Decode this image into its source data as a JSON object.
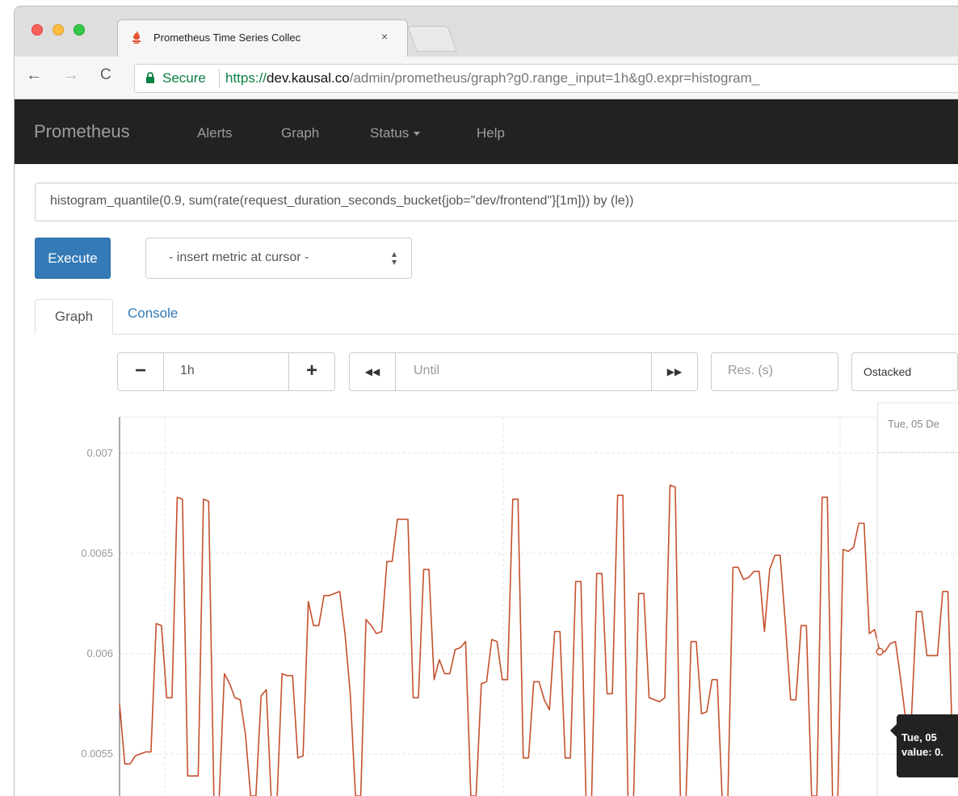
{
  "browser": {
    "tab_title": "Prometheus Time Series Collec",
    "tab_close": "×",
    "secure_label": "Secure",
    "url_scheme": "https://",
    "url_host": "dev.kausal.co",
    "url_rest": "/admin/prometheus/graph?g0.range_input=1h&g0.expr=histogram_",
    "nav_back": "←",
    "nav_forward": "→",
    "nav_reload": "C"
  },
  "navbar": {
    "brand": "Prometheus",
    "alerts": "Alerts",
    "graph": "Graph",
    "status": "Status",
    "help": "Help"
  },
  "query": {
    "expression": "histogram_quantile(0.9, sum(rate(request_duration_seconds_bucket{job=\"dev/frontend\"}[1m])) by (le))",
    "execute_label": "Execute",
    "metric_select": "- insert metric at cursor -",
    "select_arrows": "▲▼"
  },
  "tabs": {
    "graph": "Graph",
    "console": "Console"
  },
  "controls": {
    "range_minus": "−",
    "range_value": "1h",
    "range_plus": "+",
    "until_back": "◀◀",
    "until_placeholder": "Until",
    "until_forward": "▶▶",
    "res_placeholder": "Res. (s)",
    "stacked_label": "stacked",
    "stacked_radio": "O"
  },
  "chart_data": {
    "type": "line",
    "yticks": [
      "0.007",
      "0.0065",
      "0.006",
      "0.0055"
    ],
    "ylim": [
      0.00529,
      0.00718
    ],
    "hover_time_label": "Tue, 05 De",
    "tooltip_line1": "Tue, 05",
    "tooltip_line2": "value: 0.",
    "color": "#c5502d",
    "values": [
      0.00575,
      0.00545,
      0.00545,
      0.00549,
      0.0055,
      0.00551,
      0.00551,
      0.00615,
      0.00614,
      0.00578,
      0.00578,
      0.00678,
      0.00677,
      0.00539,
      0.00539,
      0.00539,
      0.00677,
      0.00676,
      0.00528,
      0.00528,
      0.0059,
      0.00585,
      0.00578,
      0.00577,
      0.0056,
      0.00529,
      0.00529,
      0.00579,
      0.00582,
      0.00524,
      0.00524,
      0.0059,
      0.00589,
      0.00589,
      0.00548,
      0.00549,
      0.00626,
      0.00614,
      0.00614,
      0.00629,
      0.00629,
      0.0063,
      0.00631,
      0.0061,
      0.0058,
      0.00529,
      0.00529,
      0.00617,
      0.00614,
      0.0061,
      0.00611,
      0.00646,
      0.00646,
      0.00667,
      0.00667,
      0.00667,
      0.00578,
      0.00578,
      0.00642,
      0.00642,
      0.00587,
      0.00597,
      0.0059,
      0.0059,
      0.00602,
      0.00603,
      0.00606,
      0.00529,
      0.00529,
      0.00585,
      0.00586,
      0.00607,
      0.00606,
      0.00587,
      0.00587,
      0.00677,
      0.00677,
      0.00548,
      0.00548,
      0.00586,
      0.00586,
      0.00577,
      0.00572,
      0.00611,
      0.00611,
      0.00548,
      0.00548,
      0.00636,
      0.00636,
      0.00524,
      0.00524,
      0.0064,
      0.0064,
      0.0058,
      0.0058,
      0.00679,
      0.00679,
      0.00524,
      0.00524,
      0.0063,
      0.0063,
      0.00578,
      0.00577,
      0.00576,
      0.00578,
      0.00684,
      0.00683,
      0.00524,
      0.00524,
      0.00606,
      0.00606,
      0.0057,
      0.00571,
      0.00587,
      0.00587,
      0.00524,
      0.00524,
      0.00643,
      0.00643,
      0.00637,
      0.00638,
      0.00641,
      0.00641,
      0.00611,
      0.00642,
      0.00649,
      0.00649,
      0.00615,
      0.00577,
      0.00577,
      0.00614,
      0.00614,
      0.00529,
      0.00529,
      0.00678,
      0.00678,
      0.00528,
      0.00528,
      0.00652,
      0.00651,
      0.00653,
      0.00665,
      0.00665,
      0.0061,
      0.00612,
      0.00601,
      0.00601,
      0.00605,
      0.00606,
      0.00587,
      0.00566,
      0.00566,
      0.00621,
      0.00621,
      0.00599,
      0.00599,
      0.00599,
      0.00631,
      0.00631,
      0.00543,
      0.00543,
      0.00583,
      0.00583,
      0.00524
    ]
  }
}
